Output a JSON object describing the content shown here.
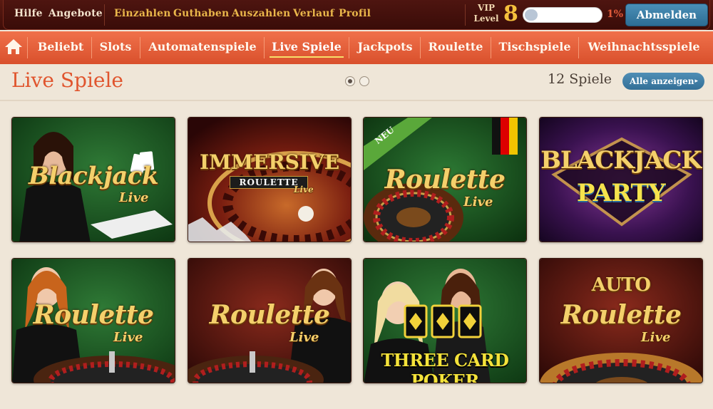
{
  "header": {
    "links_left": [
      "Hilfe",
      "Angebote"
    ],
    "links_account": [
      "Einzahlen",
      "Guthaben",
      "Auszahlen",
      "Verlauf",
      "Profil"
    ],
    "vip_label_line1": "VIP",
    "vip_label_line2": "Level",
    "vip_level": "8",
    "vip_progress": 0.01,
    "vip_progress_text": "1%",
    "logout_label": "Abmelden"
  },
  "nav": {
    "items": [
      "Beliebt",
      "Slots",
      "Automatenspiele",
      "Live Spiele",
      "Jackpots",
      "Roulette",
      "Tischspiele",
      "Weihnachtsspiele"
    ],
    "active": "Live Spiele"
  },
  "section": {
    "title": "Live Spiele",
    "count_text": "12 Spiele",
    "all_label": "Alle anzeigen",
    "arrow": "▸",
    "pages": 2,
    "current_page": 1
  },
  "games": [
    {
      "title": "Blackjack",
      "sub": "Live",
      "theme": "green-dealer"
    },
    {
      "title": "IMMERSIVE",
      "sub": "ROULETTE",
      "sub2": "Live",
      "theme": "immersive"
    },
    {
      "title": "Roulette",
      "sub": "Live",
      "badge": "NEU",
      "theme": "green-wheel"
    },
    {
      "title": "BLACKJACK",
      "sub": "PARTY",
      "theme": "party"
    },
    {
      "title": "Roulette",
      "sub": "Live",
      "theme": "green-dealer2"
    },
    {
      "title": "Roulette",
      "sub": "Live",
      "theme": "red-dealer"
    },
    {
      "title": "THREE CARD POKER",
      "theme": "poker"
    },
    {
      "title": "Roulette",
      "sub": "Live",
      "top": "AUTO",
      "theme": "auto"
    }
  ],
  "colors": {
    "header_bg": "#3e0d08",
    "nav_bg": "#e0562f",
    "accent_gold": "#e9b64a",
    "title_red": "#e0552e",
    "button_blue": "#3a79a2"
  }
}
